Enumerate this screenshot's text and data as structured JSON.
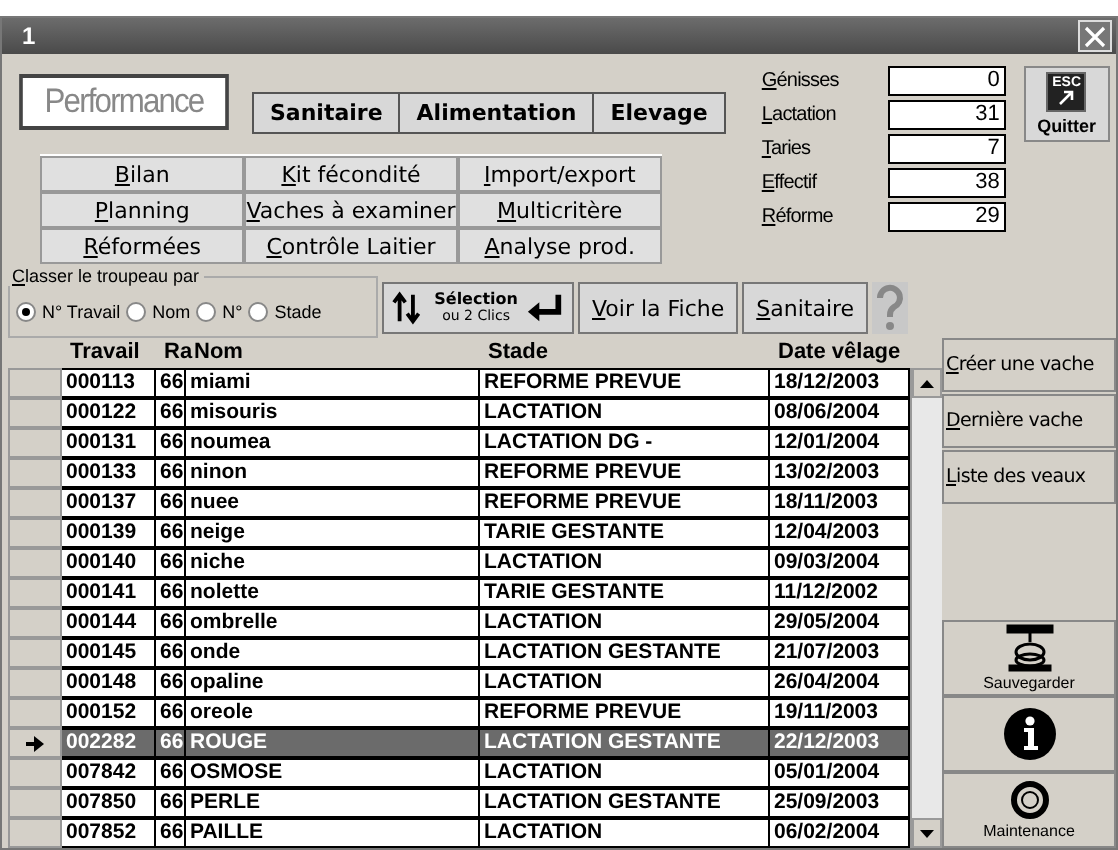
{
  "window": {
    "title": "1"
  },
  "logo": "Performance",
  "tabs": [
    {
      "label": "Sanitaire"
    },
    {
      "label": "Alimentation"
    },
    {
      "label": "Elevage"
    }
  ],
  "menu": [
    "Bilan",
    "Kit fécondité",
    "Import/export",
    "Planning",
    "Vaches à examiner",
    "Multicritère",
    "Réformées",
    "Contrôle Laitier",
    "Analyse prod."
  ],
  "counters": [
    {
      "label": "Génisses",
      "value": "0"
    },
    {
      "label": "Lactation",
      "value": "31"
    },
    {
      "label": "Taries",
      "value": "7"
    },
    {
      "label": "Effectif",
      "value": "38"
    },
    {
      "label": "Réforme",
      "value": "29"
    }
  ],
  "quit": {
    "key": "ESC",
    "label": "Quitter"
  },
  "sort": {
    "title": "Classer le troupeau par",
    "options": [
      {
        "label": "N° Travail",
        "selected": true
      },
      {
        "label": "Nom",
        "selected": false
      },
      {
        "label": "N°",
        "selected": false
      },
      {
        "label": "Stade",
        "selected": false
      }
    ]
  },
  "selection_button": {
    "label": "Sélection",
    "sub": "ou 2 Clics"
  },
  "buttons": [
    "Voir la Fiche",
    "Sanitaire"
  ],
  "table": {
    "columns": [
      "Travail",
      "Ra",
      "Nom",
      "Stade",
      "Date vêlage"
    ],
    "rows": [
      {
        "cells": [
          "000113",
          "66",
          "miami",
          "REFORME PREVUE",
          "18/12/2003"
        ],
        "selected": false
      },
      {
        "cells": [
          "000122",
          "66",
          "misouris",
          "LACTATION",
          "08/06/2004"
        ],
        "selected": false
      },
      {
        "cells": [
          "000131",
          "66",
          "noumea",
          "LACTATION DG -",
          "12/01/2004"
        ],
        "selected": false
      },
      {
        "cells": [
          "000133",
          "66",
          "ninon",
          "REFORME PREVUE",
          "13/02/2003"
        ],
        "selected": false
      },
      {
        "cells": [
          "000137",
          "66",
          "nuee",
          "REFORME PREVUE",
          "18/11/2003"
        ],
        "selected": false
      },
      {
        "cells": [
          "000139",
          "66",
          "neige",
          "TARIE GESTANTE",
          "12/04/2003"
        ],
        "selected": false
      },
      {
        "cells": [
          "000140",
          "66",
          "niche",
          "LACTATION",
          "09/03/2004"
        ],
        "selected": false
      },
      {
        "cells": [
          "000141",
          "66",
          "nolette",
          "TARIE GESTANTE",
          "11/12/2002"
        ],
        "selected": false
      },
      {
        "cells": [
          "000144",
          "66",
          "ombrelle",
          "LACTATION",
          "29/05/2004"
        ],
        "selected": false
      },
      {
        "cells": [
          "000145",
          "66",
          "onde",
          "LACTATION GESTANTE",
          "21/07/2003"
        ],
        "selected": false
      },
      {
        "cells": [
          "000148",
          "66",
          "opaline",
          "LACTATION",
          "26/04/2004"
        ],
        "selected": false
      },
      {
        "cells": [
          "000152",
          "66",
          "oreole",
          "REFORME PREVUE",
          "19/11/2003"
        ],
        "selected": false
      },
      {
        "cells": [
          "002282",
          "66",
          "ROUGE",
          "LACTATION GESTANTE",
          "22/12/2003"
        ],
        "selected": true
      },
      {
        "cells": [
          "007842",
          "66",
          "OSMOSE",
          "LACTATION",
          "05/01/2004"
        ],
        "selected": false
      },
      {
        "cells": [
          "007850",
          "66",
          "PERLE",
          "LACTATION GESTANTE",
          "25/09/2003"
        ],
        "selected": false
      },
      {
        "cells": [
          "007852",
          "66",
          "PAILLE",
          "LACTATION",
          "06/02/2004"
        ],
        "selected": false
      }
    ]
  },
  "side_buttons": [
    "Créer une vache",
    "Dernière vache",
    "Liste des veaux"
  ],
  "tools": [
    {
      "kind": "save",
      "label": "Sauvegarder"
    },
    {
      "kind": "info"
    },
    {
      "kind": "maintenance",
      "label": "Maintenance"
    }
  ]
}
